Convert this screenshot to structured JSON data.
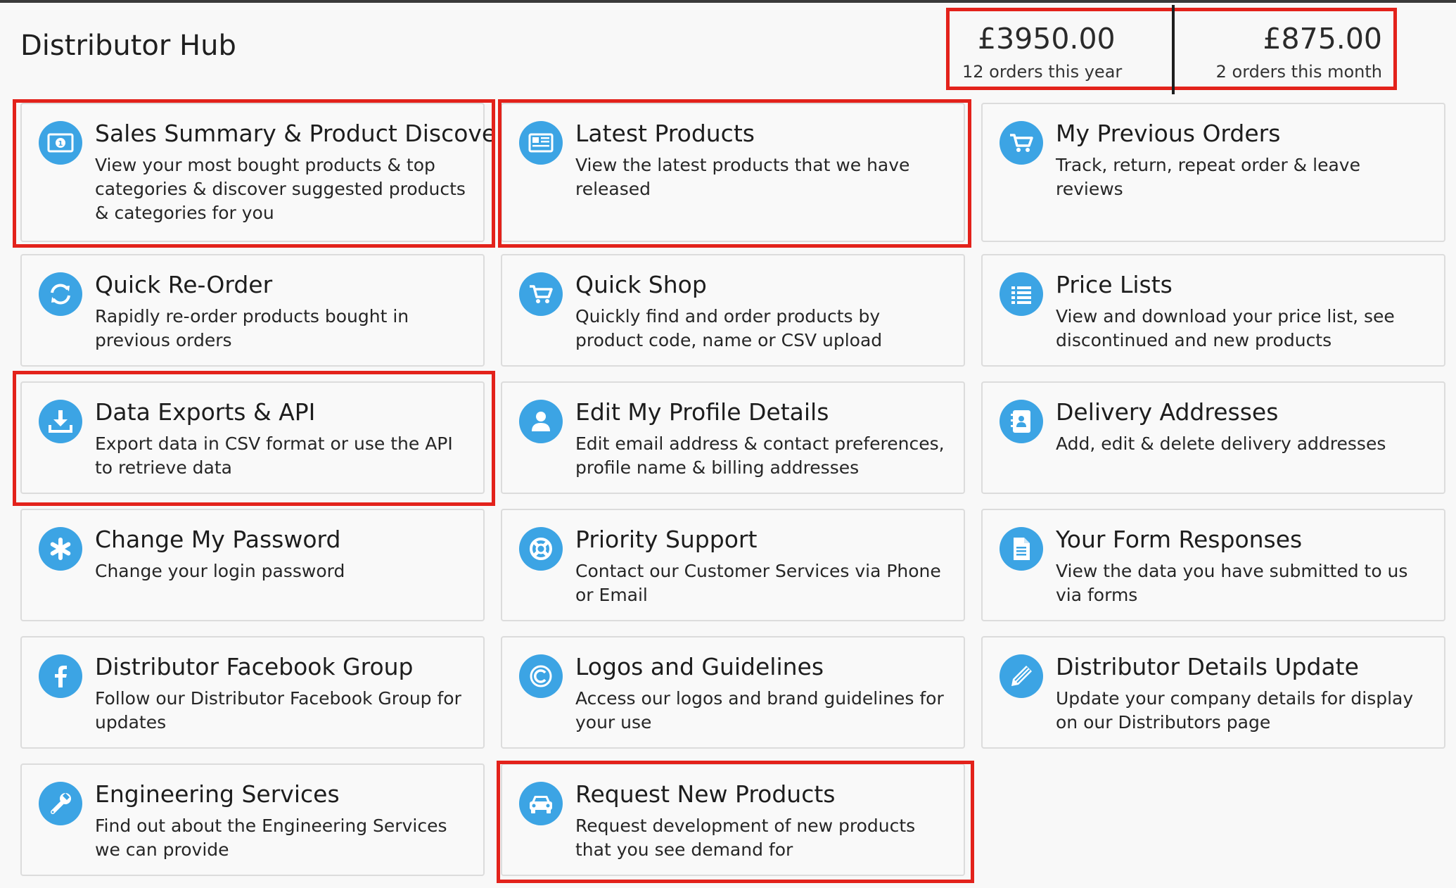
{
  "page": {
    "title": "Distributor Hub"
  },
  "stats": [
    {
      "amount": "£3950.00",
      "label": "12 orders this year"
    },
    {
      "amount": "£875.00",
      "label": "2 orders this month"
    }
  ],
  "accent": "#3ca4e4",
  "highlight_color": "#e3221b",
  "cards": [
    {
      "title": "Sales Summary & Product Discovery",
      "description": "View your most bought products & top categories & discover suggested products & categories for you",
      "icon": "money-icon"
    },
    {
      "title": "Latest Products",
      "description": "View the latest products that we have released",
      "icon": "newspaper-icon"
    },
    {
      "title": "My Previous Orders",
      "description": "Track, return, repeat order & leave reviews",
      "icon": "cart-icon"
    },
    {
      "title": "Quick Re-Order",
      "description": "Rapidly re-order products bought in previous orders",
      "icon": "refresh-icon"
    },
    {
      "title": "Quick Shop",
      "description": "Quickly find and order products by product code, name or CSV upload",
      "icon": "cart-icon"
    },
    {
      "title": "Price Lists",
      "description": "View and download your price list, see discontinued and new products",
      "icon": "list-icon"
    },
    {
      "title": "Data Exports & API",
      "description": "Export data in CSV format or use the API to retrieve data",
      "icon": "download-icon"
    },
    {
      "title": "Edit My Profile Details",
      "description": "Edit email address & contact preferences, profile name & billing addresses",
      "icon": "user-icon"
    },
    {
      "title": "Delivery Addresses",
      "description": "Add, edit & delete delivery addresses",
      "icon": "address-book-icon"
    },
    {
      "title": "Change My Password",
      "description": "Change your login password",
      "icon": "asterisk-icon"
    },
    {
      "title": "Priority Support",
      "description": "Contact our Customer Services via Phone or Email",
      "icon": "lifebuoy-icon"
    },
    {
      "title": "Your Form Responses",
      "description": "View the data you have submitted to us via forms",
      "icon": "document-icon"
    },
    {
      "title": "Distributor Facebook Group",
      "description": "Follow our Distributor Facebook Group for updates",
      "icon": "facebook-icon"
    },
    {
      "title": "Logos and Guidelines",
      "description": "Access our logos and brand guidelines for your use",
      "icon": "copyright-icon"
    },
    {
      "title": "Distributor Details Update",
      "description": "Update your company details for display on our Distributors page",
      "icon": "pencil-icon"
    },
    {
      "title": "Engineering Services",
      "description": "Find out about the Engineering Services we can provide",
      "icon": "wrench-icon"
    },
    {
      "title": "Request New Products",
      "description": "Request development of new products that you see demand for",
      "icon": "car-icon"
    }
  ]
}
